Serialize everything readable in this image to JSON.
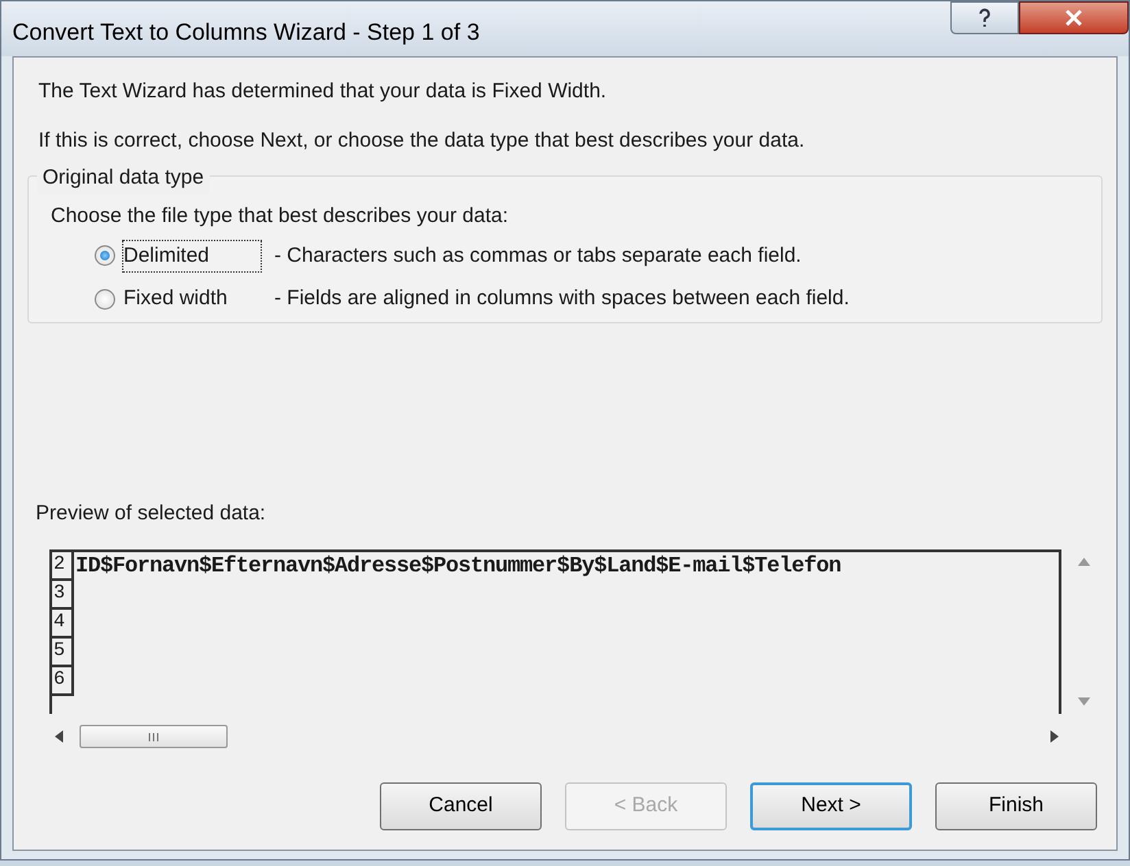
{
  "window": {
    "title": "Convert Text to Columns Wizard - Step 1 of 3"
  },
  "intro": [
    "The Text Wizard has determined that your data is Fixed Width.",
    "If this is correct, choose Next, or choose the data type that best describes your data."
  ],
  "group": {
    "title": "Original data type",
    "prompt": "Choose the file type that best describes your data:",
    "options": [
      {
        "label": "Delimited",
        "description": "- Characters such as commas or tabs separate each field.",
        "selected": true
      },
      {
        "label": "Fixed width",
        "description": "- Fields are aligned in columns with spaces between each field.",
        "selected": false
      }
    ]
  },
  "preview": {
    "label": "Preview of selected data:",
    "rows": [
      {
        "number": "2",
        "text": "ID$Fornavn$Efternavn$Adresse$Postnummer$By$Land$E-mail$Telefon"
      },
      {
        "number": "3",
        "text": ""
      },
      {
        "number": "4",
        "text": ""
      },
      {
        "number": "5",
        "text": ""
      },
      {
        "number": "6",
        "text": ""
      }
    ]
  },
  "buttons": [
    {
      "label": "Cancel",
      "disabled": false,
      "default": false
    },
    {
      "label": "< Back",
      "disabled": true,
      "default": false
    },
    {
      "label": "Next >",
      "disabled": false,
      "default": true
    },
    {
      "label": "Finish",
      "disabled": false,
      "default": false
    }
  ]
}
